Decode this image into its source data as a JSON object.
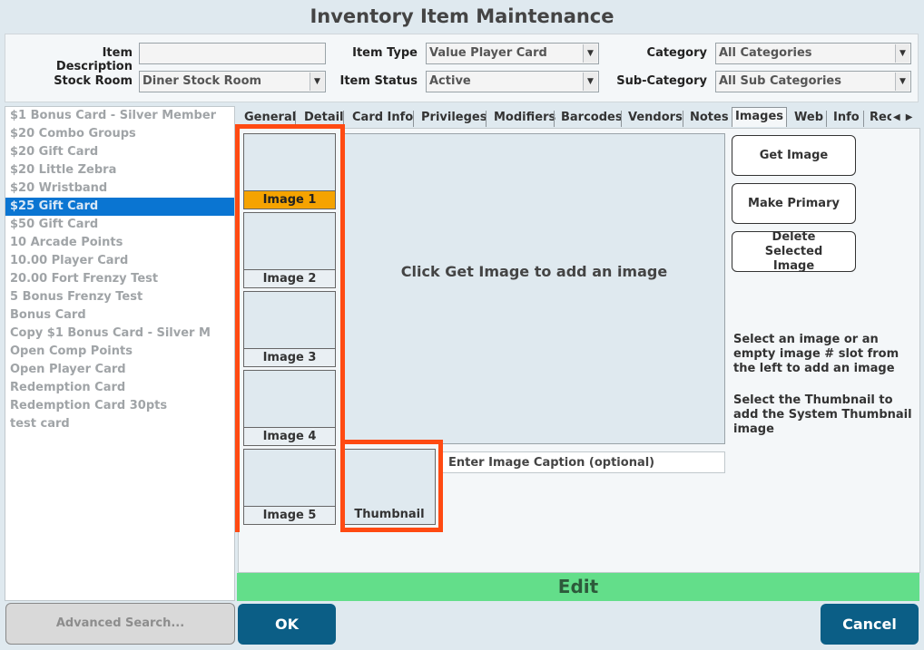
{
  "title": "Inventory Item Maintenance",
  "form": {
    "item_description_label": "Item Description",
    "item_description_value": "",
    "stock_room_label": "Stock Room",
    "stock_room_value": "Diner Stock Room",
    "item_type_label": "Item Type",
    "item_type_value": "Value Player Card",
    "item_status_label": "Item Status",
    "item_status_value": "Active",
    "category_label": "Category",
    "category_value": "All Categories",
    "sub_category_label": "Sub-Category",
    "sub_category_value": "All Sub Categories"
  },
  "items": [
    "$1 Bonus Card -  Silver Member",
    "$20 Combo Groups",
    "$20 Gift Card",
    "$20 Little Zebra",
    "$20 Wristband",
    "$25 Gift Card",
    "$50 Gift Card",
    "10 Arcade Points",
    "10.00 Player Card",
    "20.00 Fort Frenzy Test",
    "5 Bonus Frenzy Test",
    "Bonus Card",
    "Copy $1 Bonus Card -  Silver M",
    "Open Comp Points",
    "Open Player Card",
    "Redemption Card",
    "Redemption Card 30pts",
    "test card"
  ],
  "selected_item": "$25 Gift Card",
  "tabs": [
    "General",
    "Detail",
    "Card Info",
    "Privileges",
    "Modifiers",
    "Barcodes",
    "Vendors",
    "Notes",
    "Images",
    "Web",
    "Info",
    "Rec"
  ],
  "active_tab": "Images",
  "images": {
    "slots": [
      "Image 1",
      "Image 2",
      "Image 3",
      "Image 4",
      "Image 5"
    ],
    "thumbnail_label": "Thumbnail",
    "selected_slot": "Image 1",
    "preview_message": "Click Get Image to add an image",
    "caption_placeholder": "Enter Image Caption (optional)",
    "get_image": "Get Image",
    "make_primary": "Make Primary",
    "delete_selected": "Delete Selected Image",
    "hint1": "Select an image or an empty image # slot from the left to add an image",
    "hint2": "Select the Thumbnail to add the System Thumbnail image"
  },
  "mode": "Edit",
  "buttons": {
    "advanced_search": "Advanced Search...",
    "ok": "OK",
    "cancel": "Cancel"
  },
  "colors": {
    "selection_blue": "#0a75d2",
    "highlight_orange": "#ff4a12",
    "selected_slot": "#f5a300",
    "edit_green": "#63de8a",
    "button_dark": "#0b5e86"
  }
}
